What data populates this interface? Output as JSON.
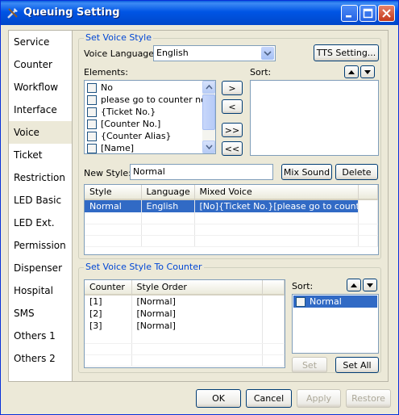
{
  "window": {
    "title": "Queuing Setting"
  },
  "nav": {
    "items": [
      {
        "label": "Service"
      },
      {
        "label": "Counter"
      },
      {
        "label": "Workflow"
      },
      {
        "label": "Interface"
      },
      {
        "label": "Voice"
      },
      {
        "label": "Ticket"
      },
      {
        "label": "Restriction"
      },
      {
        "label": "LED Basic"
      },
      {
        "label": "LED Ext."
      },
      {
        "label": "Permission"
      },
      {
        "label": "Dispenser"
      },
      {
        "label": "Hospital"
      },
      {
        "label": "SMS"
      },
      {
        "label": "Others 1"
      },
      {
        "label": "Others 2"
      }
    ],
    "active_index": 4
  },
  "voice_style": {
    "legend": "Set Voice Style",
    "language_label": "Voice Language:",
    "language_value": "English",
    "tts_button": "TTS Setting...",
    "elements_label": "Elements:",
    "sort_label": "Sort:",
    "elements": [
      {
        "label": "No"
      },
      {
        "label": "please go to counter no"
      },
      {
        "label": "{Ticket No.}"
      },
      {
        "label": "[Counter No.]"
      },
      {
        "label": "{Counter Alias}"
      },
      {
        "label": "[Name]"
      }
    ],
    "move_buttons": {
      "add": ">",
      "remove": "<",
      "add_all": ">>",
      "remove_all": "<<"
    },
    "new_style_label": "New Style:",
    "new_style_value": "Normal",
    "mix_sound_button": "Mix Sound",
    "delete_button": "Delete",
    "table": {
      "headers": [
        "Style",
        "Language",
        "Mixed Voice"
      ],
      "rows": [
        [
          "Normal",
          "English",
          "[No]{Ticket No.}[please go to counte..."
        ]
      ]
    }
  },
  "counter_style": {
    "legend": "Set Voice Style To Counter",
    "table": {
      "headers": [
        "Counter",
        "Style Order"
      ],
      "rows": [
        [
          "[1]",
          "[Normal]"
        ],
        [
          "[2]",
          "[Normal]"
        ],
        [
          "[3]",
          "[Normal]"
        ]
      ]
    },
    "sort_label": "Sort:",
    "sort_items": [
      {
        "label": "Normal"
      }
    ],
    "set_button": "Set",
    "set_all_button": "Set All"
  },
  "footer": {
    "ok": "OK",
    "cancel": "Cancel",
    "apply": "Apply",
    "restore": "Restore"
  }
}
